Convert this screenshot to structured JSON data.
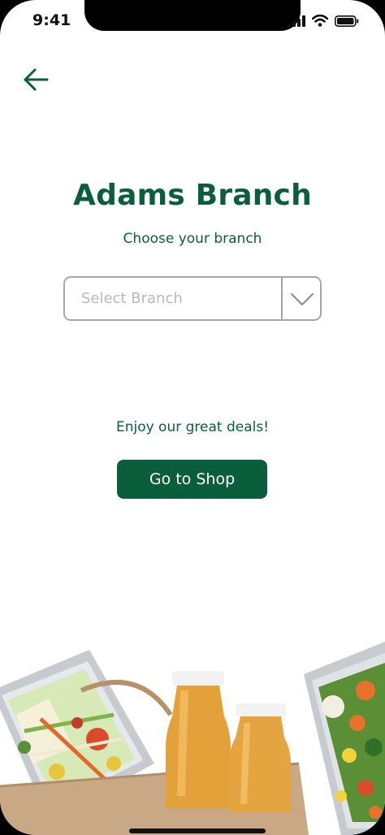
{
  "status_bar": {
    "time": "9:41",
    "icons": [
      "signal-icon",
      "wifi-icon",
      "battery-icon"
    ]
  },
  "header": {
    "back_icon": "arrow-left-icon"
  },
  "main": {
    "title": "Adams Branch",
    "subtitle": "Choose your branch",
    "branch_select": {
      "placeholder": "Select Branch",
      "dropdown_icon": "chevron-down-icon"
    },
    "deals_text": "Enjoy our great deals!",
    "shop_button_label": "Go to Shop"
  },
  "colors": {
    "brand": "#0b5e3c",
    "border": "#a7a7a7",
    "placeholder": "#b9b9b9"
  },
  "footer_image": "food-bag-image"
}
